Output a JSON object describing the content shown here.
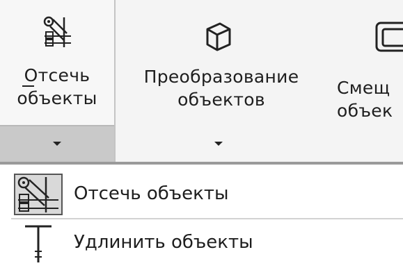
{
  "ribbon": {
    "trim_label": "Отсечь\nобъекты",
    "transform_label": "Преобразование\nобъектов",
    "offset_label": "Смещ\nобъек"
  },
  "menu": {
    "items": [
      {
        "label": "Отсечь объекты",
        "icon": "trim-icon"
      },
      {
        "label": "Удлинить объекты",
        "icon": "extend-icon"
      }
    ]
  }
}
